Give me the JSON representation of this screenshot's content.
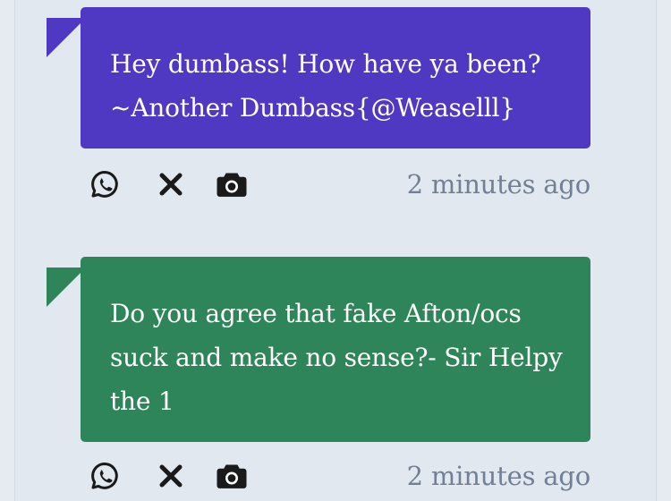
{
  "messages": [
    {
      "lines": [
        "Hey dumbass! How have ya been?",
        "~Another Dumbass{@Weaselll}"
      ],
      "timestamp": "2 minutes ago",
      "color": "#4f39c2",
      "icons": [
        "whatsapp-icon",
        "close-icon",
        "camera-icon"
      ]
    },
    {
      "lines": [
        "Do you agree that fake Afton/ocs",
        "suck and make no sense?- Sir Helpy",
        "the 1"
      ],
      "timestamp": "2 minutes ago",
      "color": "#2f855a",
      "icons": [
        "whatsapp-icon",
        "close-icon",
        "camera-icon"
      ]
    }
  ],
  "theme": {
    "background": "#e2e8f0",
    "timestamp_color": "#718096",
    "icon_color": "#1a1a1a"
  }
}
